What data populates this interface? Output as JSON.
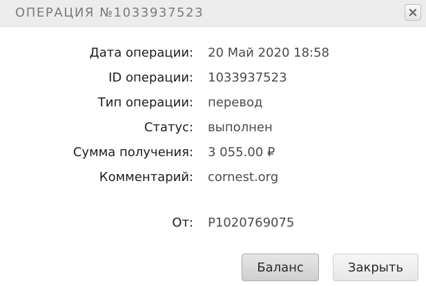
{
  "dialog": {
    "title": "ОПЕРАЦИЯ №1033937523",
    "close_icon": "close-x-icon"
  },
  "details": [
    {
      "label": "Дата операции:",
      "value": "20 Май 2020 18:58"
    },
    {
      "label": "ID операции:",
      "value": "1033937523"
    },
    {
      "label": "Тип операции:",
      "value": "перевод"
    },
    {
      "label": "Статус:",
      "value": "выполнен"
    },
    {
      "label": "Сумма получения:",
      "value": "3 055.00 ₽"
    },
    {
      "label": "Комментарий:",
      "value": "cornest.org"
    }
  ],
  "sender": {
    "label": "От:",
    "value": "P1020769075"
  },
  "buttons": {
    "balance_label": "Баланс",
    "close_label": "Закрыть"
  }
}
